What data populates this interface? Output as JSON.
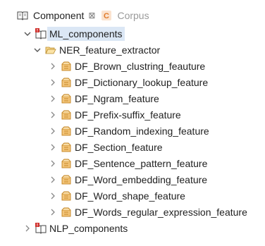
{
  "tabs": [
    {
      "label": "Component",
      "close": "⊠",
      "icon": "book-icon"
    },
    {
      "label": "Corpus",
      "icon": "class-c-icon"
    }
  ],
  "tree": {
    "root": {
      "label": "ML_components",
      "expanded": true,
      "icon": "book-error-icon"
    },
    "folder": {
      "label": "NER_feature_extractor",
      "expanded": true,
      "icon": "open-folder-icon"
    },
    "items": [
      {
        "label": "DF_Brown_clustring_feauture"
      },
      {
        "label": "DF_Dictionary_lookup_feature"
      },
      {
        "label": "DF_Ngram_feature"
      },
      {
        "label": "DF_Prefix-suffix_feature"
      },
      {
        "label": "DF_Random_indexing_feature"
      },
      {
        "label": "DF_Section_feature"
      },
      {
        "label": "DF_Sentence_pattern_feature"
      },
      {
        "label": "DF_Word_embedding_feature"
      },
      {
        "label": "DF_Word_shape_feature"
      },
      {
        "label": "DF_Words_regular_expression_feature"
      }
    ],
    "second_root": {
      "label": "NLP_components",
      "expanded": false,
      "icon": "book-error-icon"
    }
  },
  "colors": {
    "selection": "#dbe7f5",
    "package_orange": "#e8a03c",
    "error_red": "#d0312d",
    "class_orange": "#f0a35e"
  }
}
